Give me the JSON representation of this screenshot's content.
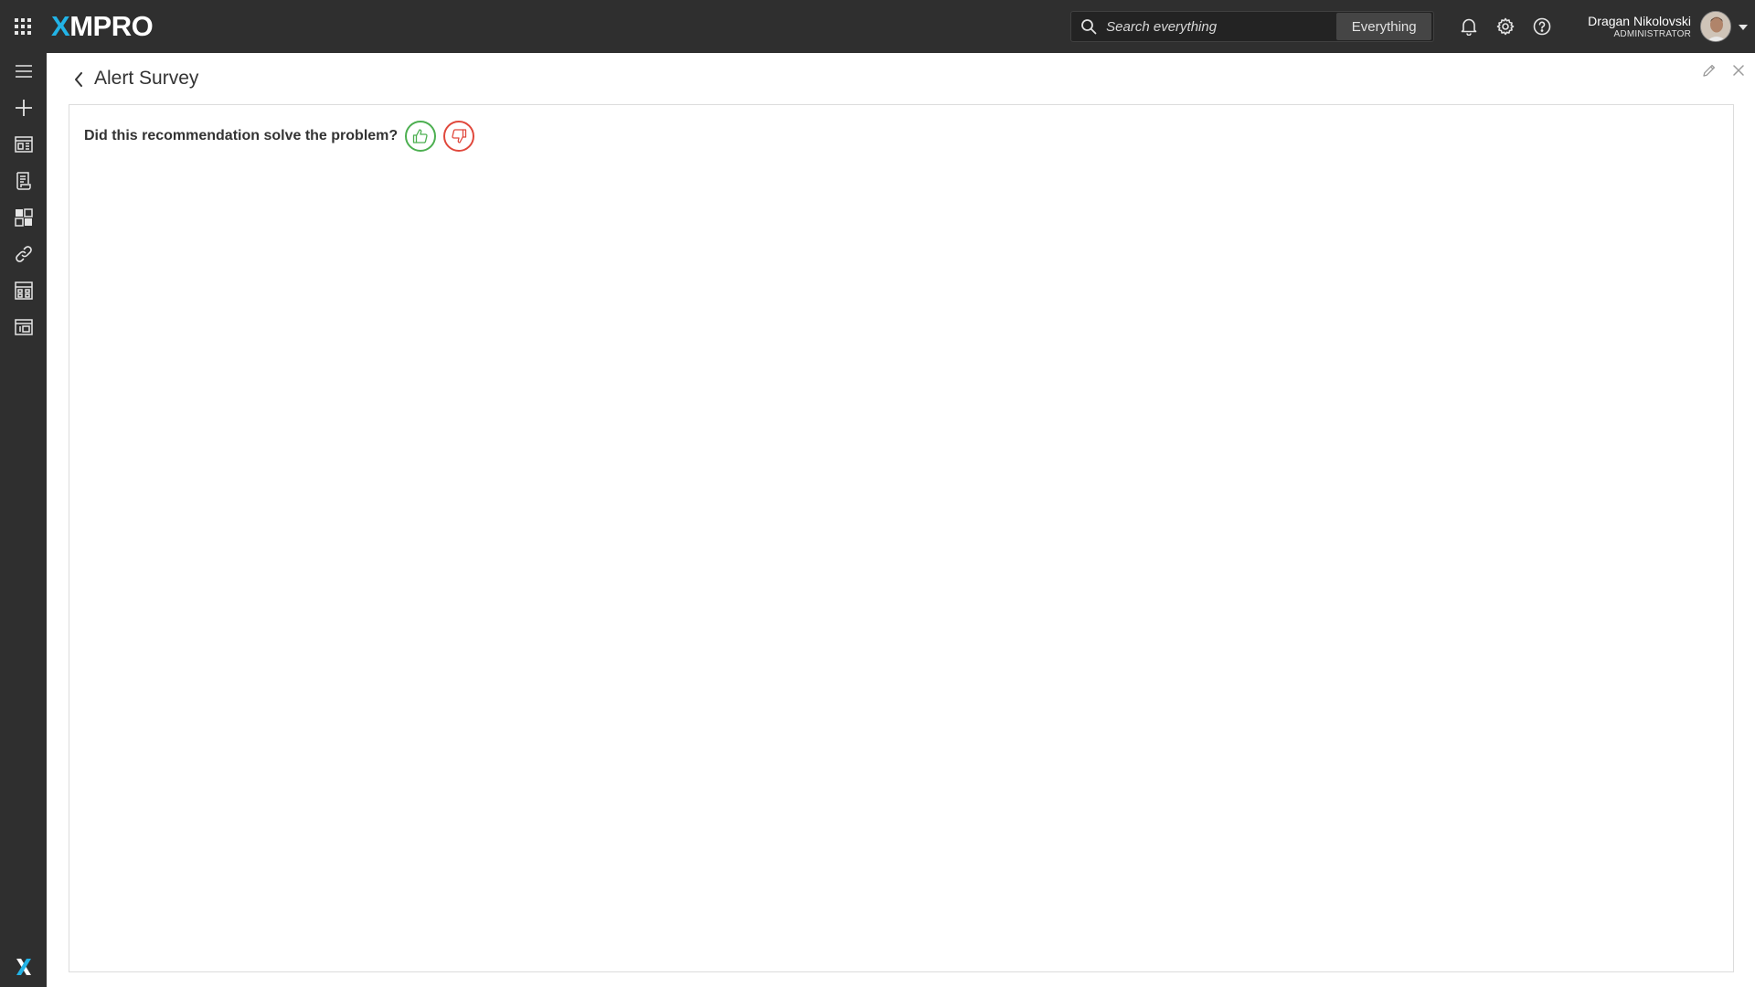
{
  "topbar": {
    "logo_accent": "X",
    "logo_rest": "MPRO",
    "search_placeholder": "Search everything",
    "search_scope": "Everything",
    "user_name": "Dragan Nikolovski",
    "user_role": "ADMINISTRATOR",
    "icons": [
      "apps-grid-icon",
      "search-icon",
      "bell-icon",
      "gear-icon",
      "help-icon",
      "avatar",
      "caret-down-icon"
    ]
  },
  "sidebar": {
    "items": [
      {
        "name": "menu-toggle",
        "icon": "hamburger-icon"
      },
      {
        "name": "create-new",
        "icon": "plus-icon"
      },
      {
        "name": "apps",
        "icon": "app-designer-icon"
      },
      {
        "name": "recommendations",
        "icon": "recommendations-icon"
      },
      {
        "name": "dashboards",
        "icon": "dashboard-icon"
      },
      {
        "name": "connections",
        "icon": "link-icon"
      },
      {
        "name": "data-streams",
        "icon": "calculator-grid-icon"
      },
      {
        "name": "templates",
        "icon": "template-icon"
      }
    ],
    "footer_logo": "xmpro-x-logo"
  },
  "page": {
    "title": "Alert Survey",
    "actions": [
      "edit-icon",
      "close-icon"
    ]
  },
  "survey": {
    "question": "Did this recommendation solve the problem?",
    "yes_icon": "thumbs-up-icon",
    "no_icon": "thumbs-down-icon"
  },
  "colors": {
    "topbar_bg": "#2f2f2f",
    "accent": "#22b3e6",
    "thumbs_up": "#4caf50",
    "thumbs_down": "#e0483c"
  }
}
